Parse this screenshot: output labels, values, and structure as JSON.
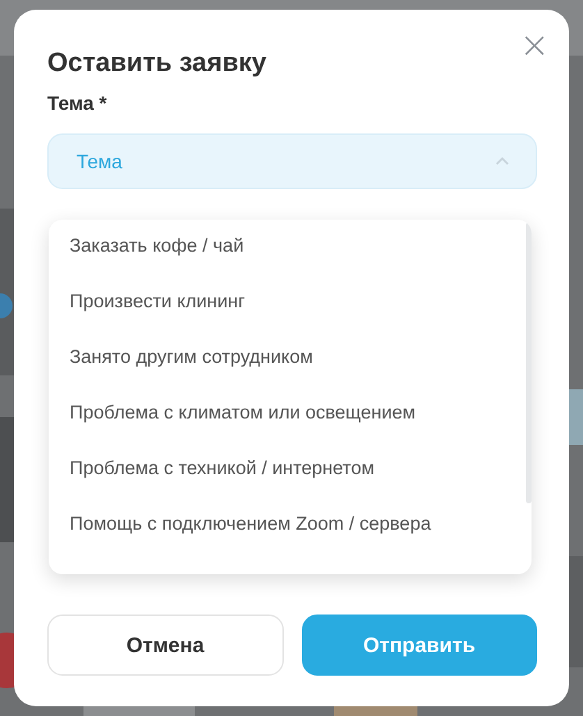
{
  "dialog": {
    "title": "Оставить заявку",
    "close_icon": "×"
  },
  "topic": {
    "label": "Тема *",
    "placeholder": "Тема",
    "expanded": true,
    "options": [
      {
        "label": "Заказать кофе / чай",
        "selected": false
      },
      {
        "label": "Произвести клининг",
        "selected": false
      },
      {
        "label": "Занято другим сотрудником",
        "selected": false
      },
      {
        "label": "Проблема с климатом или освещением",
        "selected": false
      },
      {
        "label": "Проблема с техникой / интернетом",
        "selected": false
      },
      {
        "label": "Помощь с подключением Zoom / сервера",
        "selected": false
      }
    ]
  },
  "buttons": [
    {
      "label": "Отмена",
      "kind": "secondary"
    },
    {
      "label": "Отправить",
      "kind": "primary"
    }
  ]
}
